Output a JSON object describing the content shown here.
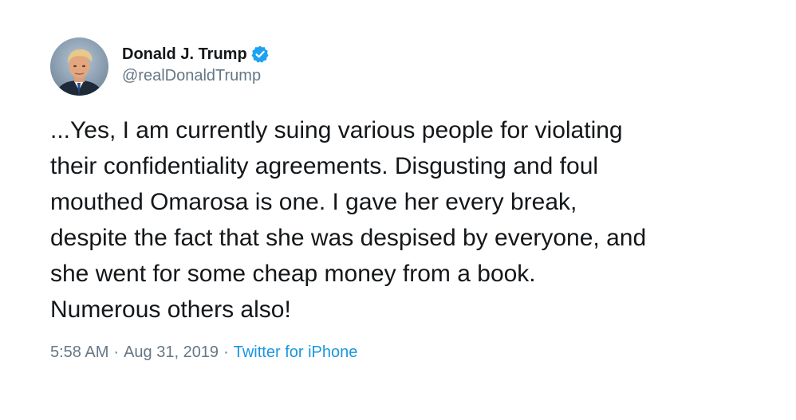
{
  "tweet": {
    "author": {
      "display_name": "Donald J. Trump",
      "handle": "@realDonaldTrump",
      "verified": true,
      "avatar_icon": "profile-photo"
    },
    "text": "...Yes, I am currently suing various people for violating\ntheir confidentiality agreements. Disgusting and foul\nmouthed Omarosa is one. I gave her every break,\ndespite the fact that she was despised by everyone, and\nshe went for some cheap money from a book.\nNumerous others also!",
    "timestamp": {
      "time": "5:58 AM",
      "separator": "·",
      "date": "Aug 31, 2019"
    },
    "source": "Twitter for iPhone",
    "colors": {
      "text": "#14171a",
      "secondary": "#657786",
      "link": "#1b95e0",
      "verified_badge": "#1da1f2"
    }
  }
}
